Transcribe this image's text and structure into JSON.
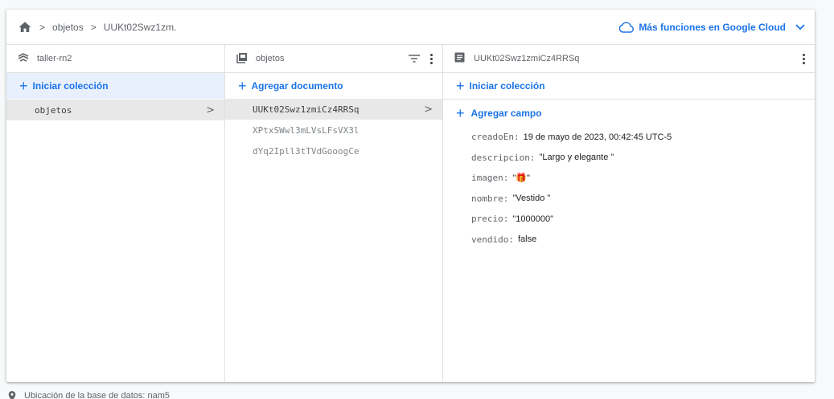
{
  "breadcrumb": {
    "items": [
      "objetos",
      "UUKt02Swz1zm."
    ]
  },
  "header": {
    "cloud_link": "Más funciones en Google Cloud"
  },
  "col_root": {
    "title": "taller-rn2",
    "action": "Iniciar colección",
    "items": [
      {
        "label": "objetos",
        "selected": true
      }
    ]
  },
  "col_collection": {
    "title": "objetos",
    "action": "Agregar documento",
    "items": [
      {
        "label": "UUKt02Swz1zmiCz4RRSq",
        "selected": true
      },
      {
        "label": "XPtxSWwl3mLVsLFsVX3l",
        "selected": false
      },
      {
        "label": "dYq2Ipll3tTVdGooogCe",
        "selected": false
      }
    ]
  },
  "col_document": {
    "title": "UUKt02Swz1zmiCz4RRSq",
    "action": "Iniciar colección",
    "add_field": "Agregar campo",
    "fields": [
      {
        "key": "creadoEn",
        "value": "19 de mayo de 2023, 00:42:45 UTC-5"
      },
      {
        "key": "descripcion",
        "value": "\"Largo y elegante \""
      },
      {
        "key": "imagen",
        "value": "\"🎁\""
      },
      {
        "key": "nombre",
        "value": "\"Vestido \""
      },
      {
        "key": "precio",
        "value": "\"1000000\""
      },
      {
        "key": "vendido",
        "value": "false"
      }
    ]
  },
  "footer": {
    "location": "Ubicación de la base de datos: nam5"
  },
  "colors": {
    "accent": "#1a73e8",
    "selected_bg": "#e8e8e8",
    "action_bg": "#e8f0fe"
  }
}
